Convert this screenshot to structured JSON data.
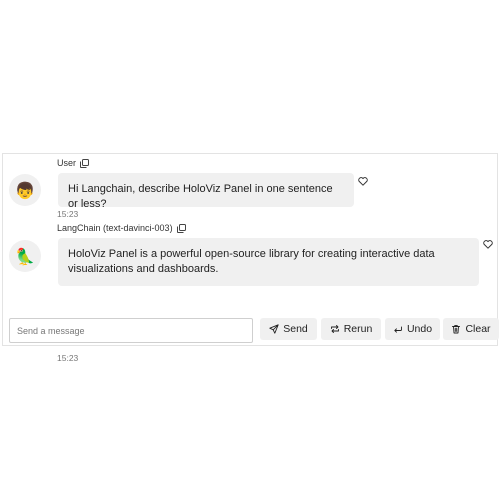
{
  "messages": [
    {
      "sender": "User",
      "avatar_emoji": "👦",
      "text": "Hi Langchain, describe HoloViz Panel in one sentence or less?",
      "timestamp": "15:23"
    },
    {
      "sender": "LangChain (text-davinci-003)",
      "avatar_emoji": "🦜",
      "text": "HoloViz Panel is a powerful open-source library for creating interactive data visualizations and dashboards.",
      "timestamp": "15:23"
    }
  ],
  "input": {
    "placeholder": "Send a message",
    "value": ""
  },
  "buttons": {
    "send": "Send",
    "rerun": "Rerun",
    "undo": "Undo",
    "clear": "Clear"
  },
  "icons": {
    "copy": "copy-icon",
    "heart": "heart-outline-icon",
    "send": "paper-plane-icon",
    "rerun": "repeat-icon",
    "undo": "undo-arrow-icon",
    "clear": "trash-icon"
  }
}
